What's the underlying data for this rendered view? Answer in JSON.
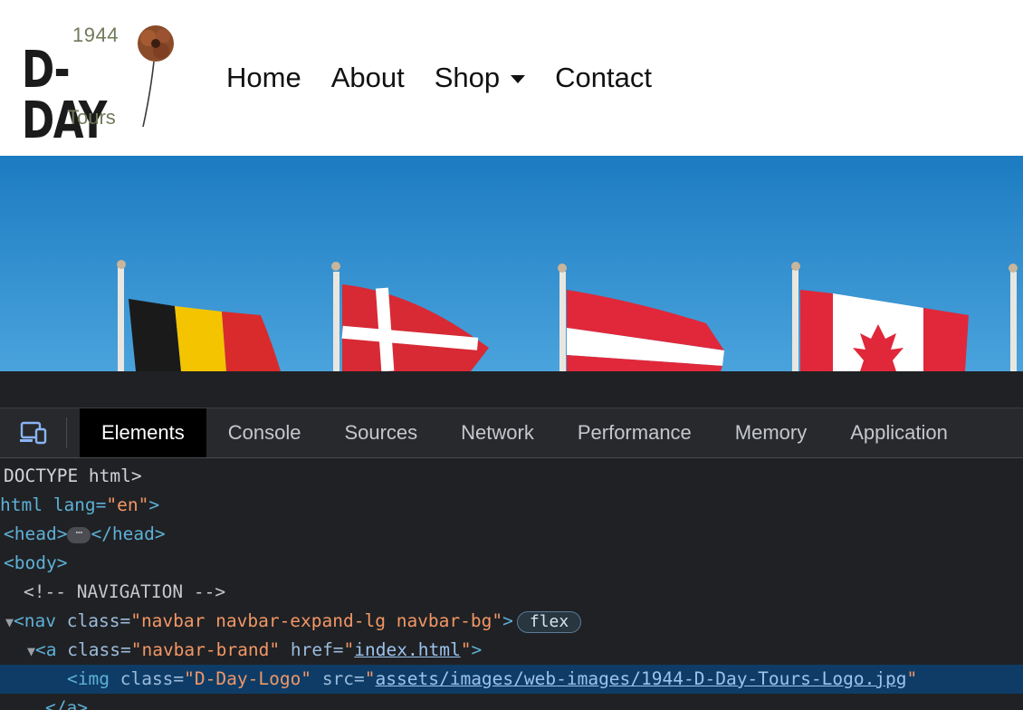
{
  "site": {
    "logo": {
      "year": "1944",
      "title": "D-DAY",
      "subtitle": "Tours"
    },
    "nav": [
      {
        "label": "Home"
      },
      {
        "label": "About"
      },
      {
        "label": "Shop"
      },
      {
        "label": "Contact"
      }
    ]
  },
  "hero": {
    "flags": [
      "belgium",
      "denmark",
      "austria",
      "canada"
    ]
  },
  "devtools": {
    "tabs": [
      {
        "label": "Elements",
        "active": true
      },
      {
        "label": "Console"
      },
      {
        "label": "Sources"
      },
      {
        "label": "Network"
      },
      {
        "label": "Performance"
      },
      {
        "label": "Memory"
      },
      {
        "label": "Application"
      }
    ],
    "dom": {
      "doctype": "DOCTYPE html>",
      "html_open": "html lang=",
      "html_lang": "\"en\"",
      "head_open": "<head>",
      "head_ellipsis": "⋯",
      "head_close": "</head>",
      "body_open": "<body>",
      "comment": "<!-- NAVIGATION -->",
      "nav_tag": "<nav",
      "nav_attr": "class=",
      "nav_class": "\"navbar navbar-expand-lg navbar-bg\"",
      "nav_close": ">",
      "nav_badge": "flex",
      "a_tag": "<a",
      "a_attr": "class=",
      "a_class": "\"navbar-brand\"",
      "a_href_attr": "href=",
      "a_href": "index.html",
      "img_tag": "<img",
      "img_attr": "class=",
      "img_class": "\"D-Day-Logo\"",
      "img_src_attr": "src=",
      "img_src": "assets/images/web-images/1944-D-Day-Tours-Logo.jpg",
      "a_close": "</a>"
    }
  },
  "colors": {
    "devtools_bg": "#202124",
    "selected_row": "#0e3c66",
    "sky": "#1f7fc4"
  }
}
